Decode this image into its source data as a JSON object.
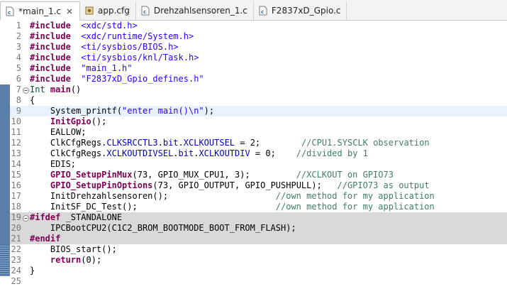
{
  "tabs": [
    {
      "label": "*main_1.c",
      "icon": "c-file-icon",
      "active": true,
      "closable": true
    },
    {
      "label": "app.cfg",
      "icon": "cfg-file-icon",
      "active": false,
      "closable": false
    },
    {
      "label": "Drehzahlsensoren_1.c",
      "icon": "c-file-icon",
      "active": false,
      "closable": false
    },
    {
      "label": "F2837xD_Gpio.c",
      "icon": "c-file-icon",
      "active": false,
      "closable": false
    }
  ],
  "lines": [
    {
      "n": "1",
      "marker": "",
      "bg": "",
      "segs": [
        [
          "kw",
          "#include"
        ],
        [
          "",
          "  "
        ],
        [
          "str",
          "<xdc/std.h>"
        ]
      ]
    },
    {
      "n": "2",
      "marker": "",
      "bg": "",
      "segs": [
        [
          "kw",
          "#include"
        ],
        [
          "",
          "  "
        ],
        [
          "str",
          "<xdc/runtime/System.h>"
        ]
      ]
    },
    {
      "n": "3",
      "marker": "",
      "bg": "",
      "segs": [
        [
          "kw",
          "#include"
        ],
        [
          "",
          "  "
        ],
        [
          "str",
          "<ti/sysbios/BIOS.h>"
        ]
      ]
    },
    {
      "n": "4",
      "marker": "",
      "bg": "",
      "segs": [
        [
          "kw",
          "#include"
        ],
        [
          "",
          "  "
        ],
        [
          "str",
          "<ti/sysbios/knl/Task.h>"
        ]
      ]
    },
    {
      "n": "5",
      "marker": "",
      "bg": "",
      "segs": [
        [
          "kw",
          "#include"
        ],
        [
          "",
          "  "
        ],
        [
          "str",
          "\"main_1.h\""
        ]
      ]
    },
    {
      "n": "6",
      "marker": "",
      "bg": "",
      "segs": [
        [
          "kw",
          "#include"
        ],
        [
          "",
          "  "
        ],
        [
          "str",
          "\"F2837xD_Gpio_defines.h\""
        ]
      ]
    },
    {
      "n": "7",
      "marker": "blue",
      "bg": "",
      "fold": true,
      "segs": [
        [
          "ty",
          "Int"
        ],
        [
          "",
          " "
        ],
        [
          "kw",
          "main"
        ],
        [
          "",
          "()"
        ]
      ]
    },
    {
      "n": "8",
      "marker": "blue",
      "bg": "",
      "segs": [
        [
          "",
          "{"
        ]
      ]
    },
    {
      "n": "9",
      "marker": "blue",
      "bg": "current",
      "segs": [
        [
          "",
          "    System_printf("
        ],
        [
          "str",
          "\"enter main()\\n\""
        ],
        [
          "",
          ");"
        ]
      ]
    },
    {
      "n": "10",
      "marker": "blue",
      "bg": "",
      "segs": [
        [
          "",
          "    "
        ],
        [
          "fn",
          "InitGpio"
        ],
        [
          "",
          "();"
        ]
      ]
    },
    {
      "n": "11",
      "marker": "blue",
      "bg": "",
      "segs": [
        [
          "",
          "    EALLOW;"
        ]
      ]
    },
    {
      "n": "12",
      "marker": "blue",
      "bg": "",
      "segs": [
        [
          "",
          "    ClkCfgRegs."
        ],
        [
          "fld",
          "CLKSRCCTL3"
        ],
        [
          "",
          "."
        ],
        [
          "fld",
          "bit"
        ],
        [
          "",
          "."
        ],
        [
          "fld",
          "XCLKOUTSEL"
        ],
        [
          "",
          " = 2;        "
        ],
        [
          "cmt",
          "//CPU1.SYSCLK observation"
        ]
      ]
    },
    {
      "n": "13",
      "marker": "blue",
      "bg": "",
      "segs": [
        [
          "",
          "    ClkCfgRegs."
        ],
        [
          "fld",
          "XCLKOUTDIVSEL"
        ],
        [
          "",
          "."
        ],
        [
          "fld",
          "bit"
        ],
        [
          "",
          "."
        ],
        [
          "fld",
          "XCLKOUTDIV"
        ],
        [
          "",
          " = 0;    "
        ],
        [
          "cmt",
          "//divided by 1"
        ]
      ]
    },
    {
      "n": "14",
      "marker": "blue",
      "bg": "",
      "segs": [
        [
          "",
          "    EDIS;"
        ]
      ]
    },
    {
      "n": "15",
      "marker": "blue",
      "bg": "",
      "segs": [
        [
          "",
          "    "
        ],
        [
          "fn",
          "GPIO_SetupPinMux"
        ],
        [
          "",
          "(73, GPIO_MUX_CPU1, 3);         "
        ],
        [
          "cmt",
          "//XCLKOUT on GPIO73"
        ]
      ]
    },
    {
      "n": "16",
      "marker": "blue",
      "bg": "",
      "segs": [
        [
          "",
          "    "
        ],
        [
          "fn",
          "GPIO_SetupPinOptions"
        ],
        [
          "",
          "(73, GPIO_OUTPUT, GPIO_PUSHPULL);   "
        ],
        [
          "cmt",
          "//GPIO73 as output"
        ]
      ]
    },
    {
      "n": "17",
      "marker": "blue",
      "bg": "",
      "segs": [
        [
          "",
          "    InitDrehzahlsensoren();                     "
        ],
        [
          "cmt",
          "//own method for my application"
        ]
      ]
    },
    {
      "n": "18",
      "marker": "blue",
      "bg": "",
      "segs": [
        [
          "",
          "    InitSF_DC_Test();                           "
        ],
        [
          "cmt",
          "//own method for my application"
        ]
      ]
    },
    {
      "n": "19",
      "marker": "blue",
      "bg": "grey",
      "fold": true,
      "segs": [
        [
          "kw",
          "#ifdef"
        ],
        [
          "",
          " _STANDALONE"
        ]
      ]
    },
    {
      "n": "20",
      "marker": "blue",
      "bg": "grey",
      "segs": [
        [
          "",
          "    IPCBootCPU2(C1C2_BROM_BOOTMODE_BOOT_FROM_FLASH);"
        ]
      ]
    },
    {
      "n": "21",
      "marker": "blue",
      "bg": "grey",
      "segs": [
        [
          "kw",
          "#endif"
        ]
      ]
    },
    {
      "n": "22",
      "marker": "blue dots",
      "bg": "",
      "segs": [
        [
          "",
          "    BIOS_start();"
        ]
      ]
    },
    {
      "n": "23",
      "marker": "blue dots",
      "bg": "",
      "segs": [
        [
          "",
          "    "
        ],
        [
          "kw",
          "return"
        ],
        [
          "",
          "(0);"
        ]
      ]
    },
    {
      "n": "24",
      "marker": "blue dots",
      "bg": "",
      "segs": [
        [
          "",
          "}"
        ]
      ]
    },
    {
      "n": "25",
      "marker": "",
      "bg": "",
      "segs": []
    }
  ]
}
